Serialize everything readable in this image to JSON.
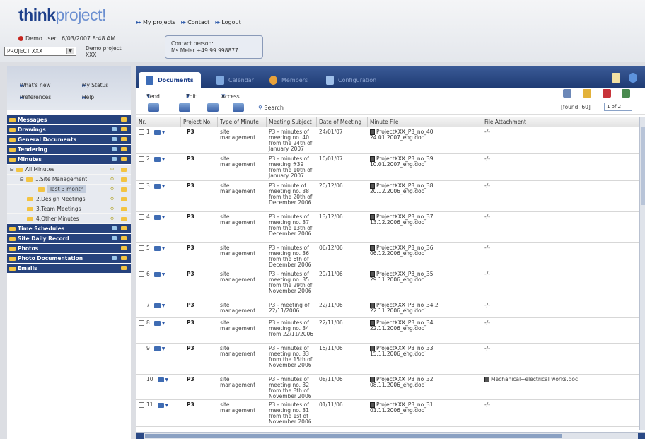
{
  "logo": {
    "part1": "think",
    "part2": "project!"
  },
  "top_nav": [
    "My projects",
    "Contact",
    "Logout"
  ],
  "user": {
    "name": "Demo user",
    "datetime": "6/03/2007 8:48 AM",
    "project_select": "PROJECT XXX",
    "project_name": "Demo project XXX"
  },
  "contact": {
    "label": "Contact person:",
    "value": "Ms Meier +49 99 998877"
  },
  "side_links": [
    "What's new",
    "My Status",
    "Preferences",
    "Help"
  ],
  "tree": {
    "top_bars": [
      "Messages",
      "Drawings",
      "General Documents",
      "Tendering",
      "Minutes"
    ],
    "subs": [
      "All Minutes",
      "1.Site Management",
      "last 3 month",
      "2.Design Meetings",
      "3.Team Meetings",
      "4.Other Minutes"
    ],
    "bottom_bars": [
      "Time Schedules",
      "Site Daily Record",
      "Photos",
      "Photo Documentation",
      "Emails"
    ]
  },
  "tabs": [
    "Documents",
    "Calendar",
    "Members",
    "Configuration"
  ],
  "toolbar": {
    "send": "Send",
    "edit": "Edit",
    "access": "Access",
    "search": "Search",
    "found": "[found: 60]",
    "page": "1 of 2"
  },
  "columns": [
    "Nr.",
    "Project No.",
    "Type of Minute",
    "Meeting Subject",
    "Date of Meeting",
    "Minute File",
    "File Attachment"
  ],
  "rows": [
    {
      "nr": "1",
      "proj": "P3",
      "type": "site management",
      "subject": "P3 - minutes of meeting no. 40 from the 24th of January 2007",
      "date": "24/01/07",
      "file": "ProjectXXX_P3_no_40 24.01.2007_eng.doc",
      "attach": "-/-"
    },
    {
      "nr": "2",
      "proj": "P3",
      "type": "site management",
      "subject": "P3 - minutes of meeting #39 from the 10th of January 2007",
      "date": "10/01/07",
      "file": "ProjectXXX_P3_no_39 10.01.2007_eng.doc",
      "attach": "-/-"
    },
    {
      "nr": "3",
      "proj": "P3",
      "type": "site management",
      "subject": "P3 - minute of meeting no. 38 from the 20th of December 2006",
      "date": "20/12/06",
      "file": "ProjectXXX_P3_no_38 20.12.2006_eng.doc",
      "attach": "-/-"
    },
    {
      "nr": "4",
      "proj": "P3",
      "type": "site management",
      "subject": "P3 - minutes of meeting no. 37 from the 13th of December 2006",
      "date": "13/12/06",
      "file": "ProjectXXX_P3_no_37 13.12.2006_eng.doc",
      "attach": "-/-"
    },
    {
      "nr": "5",
      "proj": "P3",
      "type": "site management",
      "subject": "P3 - minutes of meeting no. 36 from the 6th of December 2006",
      "date": "06/12/06",
      "file": "ProjectXXX_P3_no_36 06.12.2006_eng.doc",
      "attach": "-/-"
    },
    {
      "nr": "6",
      "proj": "P3",
      "type": "site management",
      "subject": "P3 - minutes of meeting no. 35 from the 29th of November 2006",
      "date": "29/11/06",
      "file": "ProjectXXX_P3_no_35 29.11.2006_eng.doc",
      "attach": "-/-"
    },
    {
      "nr": "7",
      "proj": "P3",
      "type": "site management",
      "subject": "P3 - meeting of 22/11/2006",
      "date": "22/11/06",
      "file": "ProjectXXX_P3_no_34.2 22.11.2006_eng.doc",
      "attach": "-/-"
    },
    {
      "nr": "8",
      "proj": "P3",
      "type": "site management",
      "subject": "P3 - minutes of meeting no. 34 from 22/11/2006",
      "date": "22/11/06",
      "file": "ProjectXXX_P3_no_34 22.11.2006_eng.doc",
      "attach": "-/-"
    },
    {
      "nr": "9",
      "proj": "P3",
      "type": "site management",
      "subject": "P3 - minutes of meeting no. 33 from the 15th of November 2006",
      "date": "15/11/06",
      "file": "ProjectXXX_P3_no_33 15.11.2006_eng.doc",
      "attach": "-/-"
    },
    {
      "nr": "10",
      "proj": "P3",
      "type": "site management",
      "subject": "P3 - minutes of meeting no. 32 from the 8th of November 2006",
      "date": "08/11/06",
      "file": "ProjectXXX_P3_no_32 08.11.2006_eng.doc",
      "attach": "Mechanical+electrical works.doc"
    },
    {
      "nr": "11",
      "proj": "P3",
      "type": "site management",
      "subject": "P3 - minutes of meeting no. 31 from the 1st of November 2006",
      "date": "01/11/06",
      "file": "ProjectXXX_P3_no_31 01.11.2006_eng.doc",
      "attach": "-/-"
    }
  ]
}
